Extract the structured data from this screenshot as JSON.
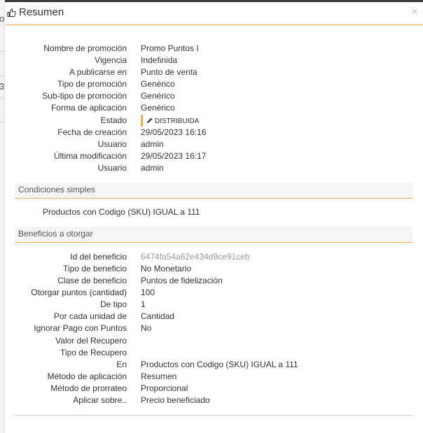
{
  "background": {
    "fragment_o": "o",
    "fragment_3": "3"
  },
  "dialog": {
    "title": "Resumen",
    "close_glyph": "×"
  },
  "summary": [
    {
      "label": "Nombre de promoción",
      "value": "Promo Puntos I"
    },
    {
      "label": "Vigencia",
      "value": "Indefinida"
    },
    {
      "label": "A publicarse en",
      "value": "Punto de venta"
    },
    {
      "label": "Tipo de promoción",
      "value": "Genérico"
    },
    {
      "label": "Sub-tipo de promoción",
      "value": "Genérico"
    },
    {
      "label": "Forma de aplicación",
      "value": "Genérico"
    },
    {
      "label": "Estado",
      "value": "DISTRIBUIDA"
    },
    {
      "label": "Fecha de creación",
      "value": "29/05/2023 16:16"
    },
    {
      "label": "Usuario",
      "value": "admin"
    },
    {
      "label": "Última modificación",
      "value": "29/05/2023 16:17"
    },
    {
      "label": "Usuario",
      "value": "admin"
    }
  ],
  "conditions": {
    "header": "Condiciones simples",
    "items": [
      "Productos con Codigo (SKU) IGUAL a 111"
    ]
  },
  "benefits": {
    "header": "Beneficios a otorgar",
    "rows": [
      {
        "label": "Id del beneficio",
        "value": "6474fa54a62e434d9ce91ceb"
      },
      {
        "label": "Tipo de beneficio",
        "value": "No Monetario"
      },
      {
        "label": "Clase de beneficio",
        "value": "Puntos de fidelización"
      },
      {
        "label": "Otorgar puntos (cantidad)",
        "value": "100"
      },
      {
        "label": "De tipo",
        "value": "1"
      },
      {
        "label": "Por cada unidad de",
        "value": "Cantidad"
      },
      {
        "label": "Ignorar Pago con Puntos",
        "value": "No"
      },
      {
        "label": "Valor del Recupero",
        "value": ""
      },
      {
        "label": "Tipo de Recupero",
        "value": ""
      },
      {
        "label": "En",
        "value": "Productos con Codigo (SKU) IGUAL a 111"
      },
      {
        "label": "Método de aplicación",
        "value": "Resumen"
      },
      {
        "label": "Método de prorrateo",
        "value": "Proporcional"
      },
      {
        "label": "Aplicar sobre..",
        "value": "Precio beneficiado"
      }
    ]
  },
  "colors": {
    "accent": "#f0ad4e",
    "text": "#333333",
    "muted": "#9a9a9a",
    "section_bg": "#f5f5f5"
  },
  "icons": {
    "header": "thumbs-up-icon",
    "estado": "pencil-icon",
    "close": "close-icon"
  }
}
